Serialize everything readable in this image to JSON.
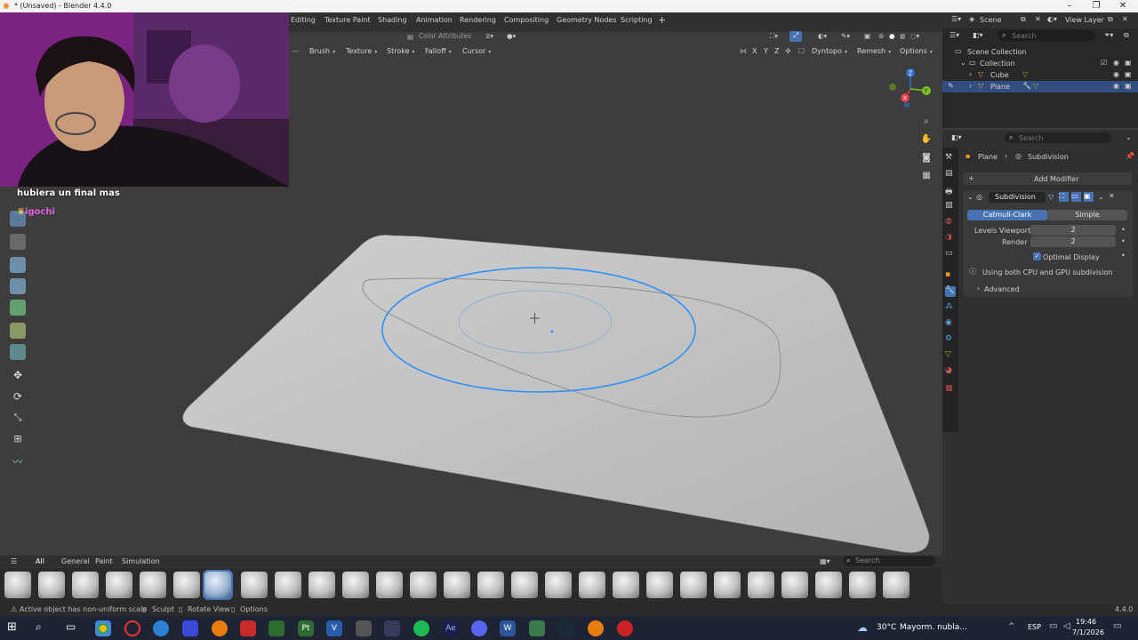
{
  "window": {
    "title": "* (Unsaved) - Blender 4.4.0"
  },
  "workspaces": [
    "Editing",
    "Texture Paint",
    "Shading",
    "Animation",
    "Rendering",
    "Compositing",
    "Geometry Nodes",
    "Scripting"
  ],
  "workspace_add": "+",
  "scene": {
    "label": "Scene",
    "view_layer": "View Layer",
    "search_placeholder": "Search"
  },
  "header2": {
    "color_attributes": "Color Attributes"
  },
  "sculpt_menus": [
    "Brush",
    "Texture",
    "Stroke",
    "Falloff",
    "Cursor"
  ],
  "axis_labels": [
    "X",
    "Y",
    "Z"
  ],
  "header_right": {
    "dyntopo": "Dyntopo",
    "remesh": "Remesh",
    "options": "Options"
  },
  "stream": {
    "chat_line1": "hubiera un final mas",
    "chat_user": "igochi"
  },
  "gizmo": {
    "x": "X",
    "y": "Y",
    "z": "Z"
  },
  "outliner": {
    "scene_collection": "Scene Collection",
    "items": [
      {
        "name": "Collection"
      },
      {
        "name": "Cube"
      },
      {
        "name": "Plane"
      }
    ]
  },
  "properties": {
    "search_placeholder": "Search",
    "breadcrumb_object": "Plane",
    "breadcrumb_modifier": "Subdivision",
    "add_modifier": "Add Modifier",
    "modifier_name": "Subdivision",
    "mode_catmull": "Catmull-Clark",
    "mode_simple": "Simple",
    "levels_viewport_label": "Levels Viewport",
    "levels_viewport_value": "2",
    "render_label": "Render",
    "render_value": "2",
    "optimal_display": "Optimal Display",
    "info": "Using both CPU and GPU subdivision",
    "advanced": "Advanced"
  },
  "bottom_tabs": [
    "All",
    "General",
    "Paint",
    "Simulation"
  ],
  "asset_search_placeholder": "Search",
  "status": {
    "message": "Active object has non-uniform scale",
    "sculpt": "Sculpt",
    "rotate_view": "Rotate View",
    "options": "Options",
    "version": "4.4.0"
  },
  "taskbar": {
    "weather_temp": "30°C",
    "weather_desc": "Mayorm. nubla...",
    "lang": "ESP",
    "time": "19:46",
    "date": "7/1/2026"
  },
  "colors": {
    "accent_blue": "#4772b3",
    "selection_blue": "#2f8ffb",
    "viewport_bg": "#3d3d3d"
  }
}
